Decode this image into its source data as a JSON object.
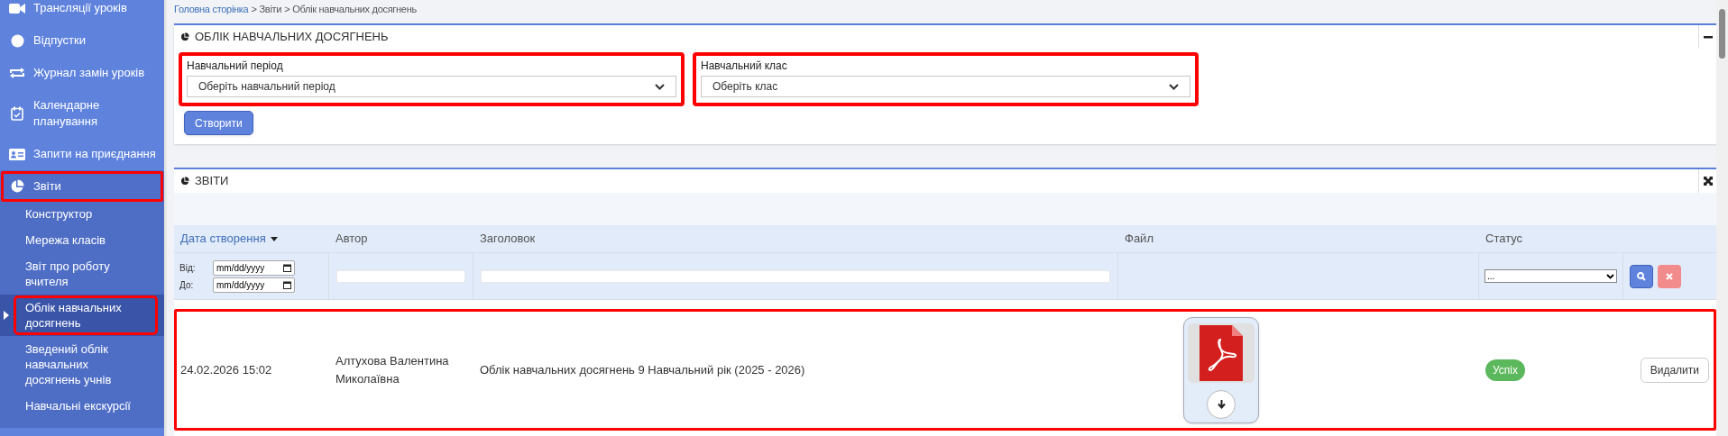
{
  "sidebar": {
    "items": [
      {
        "label": "Трансляції уроків",
        "selected": false,
        "highlighted": false
      },
      {
        "label": "Відпустки",
        "selected": false,
        "highlighted": false
      },
      {
        "label": "Журнал замін уроків",
        "selected": false,
        "highlighted": false
      },
      {
        "label": "Календарне планування",
        "selected": false,
        "highlighted": false
      },
      {
        "label": "Запити на приєднання",
        "selected": false,
        "highlighted": false
      },
      {
        "label": "Звіти",
        "selected": false,
        "highlighted": true,
        "expanded": true,
        "children": [
          {
            "label": "Конструктор",
            "selected": false,
            "highlighted": false
          },
          {
            "label": "Мережа класів",
            "selected": false,
            "highlighted": false
          },
          {
            "label": "Звіт про роботу вчителя",
            "selected": false,
            "highlighted": false
          },
          {
            "label": "Облік навчальних досягнень",
            "selected": true,
            "highlighted": true
          },
          {
            "label": "Зведений облік навчальних досягнень учнів",
            "selected": false,
            "highlighted": false
          },
          {
            "label": "Навчальні екскурсії",
            "selected": false,
            "highlighted": false
          }
        ]
      }
    ]
  },
  "breadcrumb": [
    {
      "text": "Головна сторінка",
      "kind": "link"
    },
    {
      "text": ">",
      "kind": "separator"
    },
    {
      "text": "Звіти",
      "kind": "page"
    },
    {
      "text": ">",
      "kind": "separator"
    },
    {
      "text": "Облік навчальних досягнень",
      "kind": "page"
    }
  ],
  "form_panel": {
    "title": "ОБЛІК НАВЧАЛЬНИХ ДОСЯГНЕНЬ",
    "fields": [
      {
        "label": "Навчальний період",
        "value": "Оберіть навчальний період",
        "highlighted": true
      },
      {
        "label": "Навчальний клас",
        "value": "Оберіть клас",
        "highlighted": true
      }
    ],
    "button": "Створити"
  },
  "reports_panel": {
    "title": "ЗВІТИ",
    "table": {
      "columns": [
        {
          "label": "Дата створення",
          "sorted": true
        },
        {
          "label": "Автор",
          "sorted": false
        },
        {
          "label": "Заголовок",
          "sorted": false
        },
        {
          "label": "Файл",
          "sorted": false
        },
        {
          "label": "Статус",
          "sorted": false
        }
      ],
      "filters": {
        "from_label": "Від:",
        "to_label": "До:",
        "from_value": "mm/dd/yyyy",
        "to_value": "mm/dd/yyyy",
        "status_value": "..."
      },
      "rows": [
        {
          "date": "24.02.2026 15:02",
          "author": "Алтухова Валентина Миколаївна",
          "title": "Облік навчальних досягнень 9 Навчальний рік (2025 - 2026)",
          "status": "Успіх",
          "action": "Видалити",
          "highlighted": true
        }
      ]
    }
  }
}
